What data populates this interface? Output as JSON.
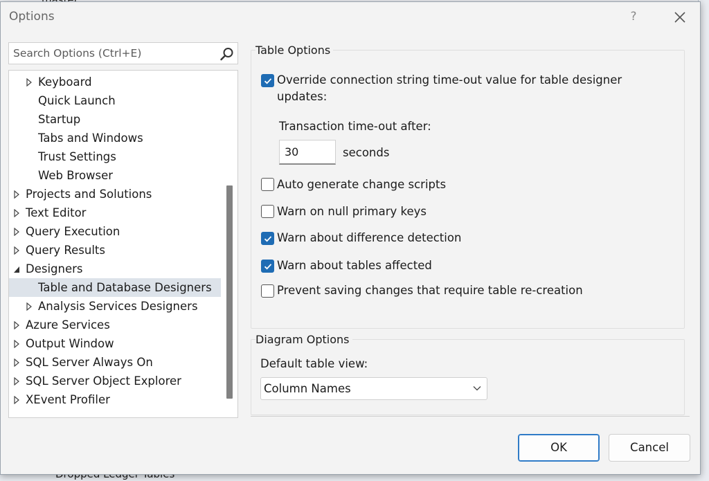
{
  "background": {
    "top_label": "master",
    "bottom_label": "Dropped Ledger Tables"
  },
  "dialog": {
    "title": "Options",
    "help": "?"
  },
  "search": {
    "placeholder": "Search Options (Ctrl+E)"
  },
  "tree": {
    "items": [
      {
        "label": "Keyboard",
        "level": 1,
        "arrow": "collapsed"
      },
      {
        "label": "Quick Launch",
        "level": 1,
        "arrow": "none"
      },
      {
        "label": "Startup",
        "level": 1,
        "arrow": "none"
      },
      {
        "label": "Tabs and Windows",
        "level": 1,
        "arrow": "none"
      },
      {
        "label": "Trust Settings",
        "level": 1,
        "arrow": "none"
      },
      {
        "label": "Web Browser",
        "level": 1,
        "arrow": "none"
      },
      {
        "label": "Projects and Solutions",
        "level": 0,
        "arrow": "collapsed"
      },
      {
        "label": "Text Editor",
        "level": 0,
        "arrow": "collapsed"
      },
      {
        "label": "Query Execution",
        "level": 0,
        "arrow": "collapsed"
      },
      {
        "label": "Query Results",
        "level": 0,
        "arrow": "collapsed"
      },
      {
        "label": "Designers",
        "level": 0,
        "arrow": "expanded"
      },
      {
        "label": "Table and Database Designers",
        "level": 1,
        "arrow": "none",
        "selected": true
      },
      {
        "label": "Analysis Services Designers",
        "level": 1,
        "arrow": "collapsed"
      },
      {
        "label": "Azure Services",
        "level": 0,
        "arrow": "collapsed"
      },
      {
        "label": "Output Window",
        "level": 0,
        "arrow": "collapsed"
      },
      {
        "label": "SQL Server Always On",
        "level": 0,
        "arrow": "collapsed"
      },
      {
        "label": "SQL Server Object Explorer",
        "level": 0,
        "arrow": "collapsed"
      },
      {
        "label": "XEvent Profiler",
        "level": 0,
        "arrow": "collapsed"
      }
    ]
  },
  "table_options": {
    "title": "Table Options",
    "override_line1": "Override connection string time-out value for table designer",
    "override_line2": "updates:",
    "override_checked": true,
    "transaction_label": "Transaction time-out after:",
    "timeout_value": "30",
    "timeout_unit": "seconds",
    "auto_generate": {
      "label": "Auto generate change scripts",
      "checked": false
    },
    "warn_null": {
      "label": "Warn on null primary keys",
      "checked": false
    },
    "warn_difference": {
      "label": "Warn about difference detection",
      "checked": true
    },
    "warn_tables": {
      "label": "Warn about tables affected",
      "checked": true
    },
    "prevent_saving": {
      "label": "Prevent saving changes that require table re-creation",
      "checked": false
    }
  },
  "diagram_options": {
    "title": "Diagram Options",
    "default_view_label": "Default table view:",
    "default_view_value": "Column Names"
  },
  "buttons": {
    "ok": "OK",
    "cancel": "Cancel"
  },
  "colors": {
    "accent": "#1f6cb4",
    "selection": "#dde3ea"
  }
}
